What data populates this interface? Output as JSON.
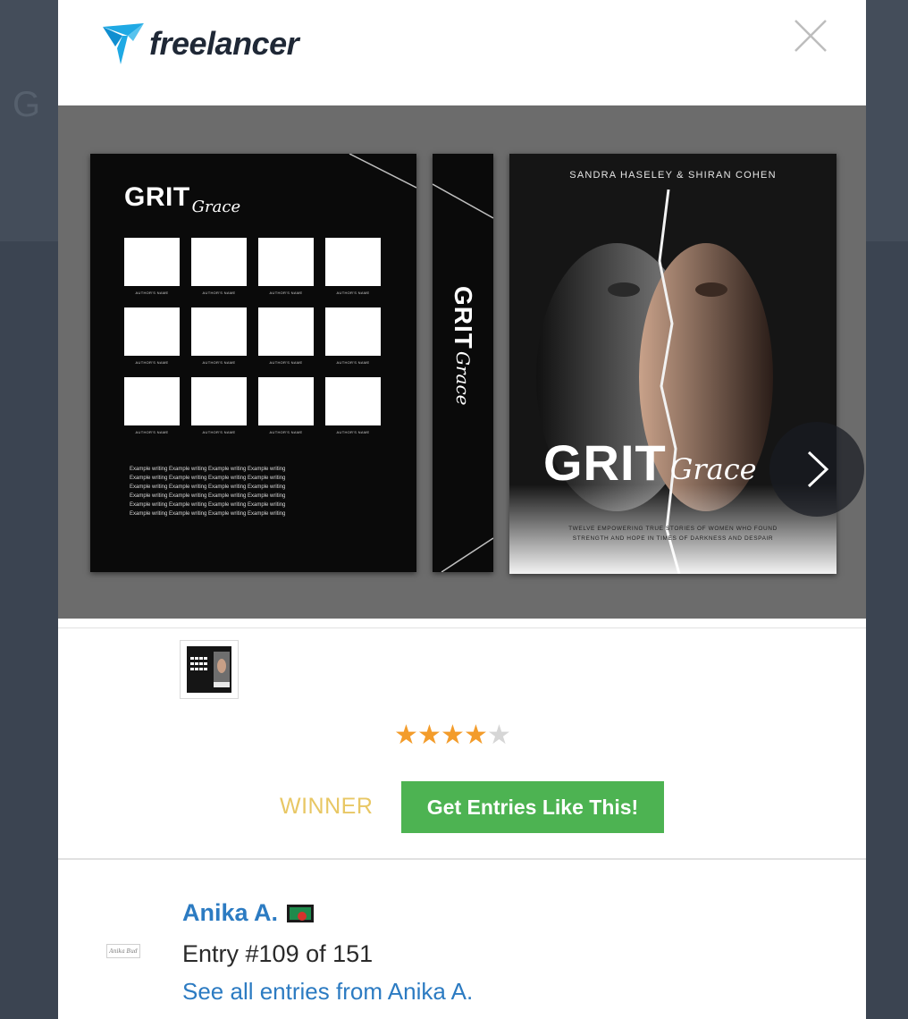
{
  "background": {
    "ghost_text": "G"
  },
  "header": {
    "logo_text": "freelancer",
    "logo_color": "#1fa9e4"
  },
  "design": {
    "back_cover": {
      "title_grit": "GRIT",
      "title_grace": "Grace",
      "photo_label": "AUTHOR'S NAME",
      "blurb_line": "Example writing Example writing Example writing Example writing",
      "blurb_line_count": 6,
      "photo_count": 12
    },
    "spine": {
      "title_grit": "GRIT",
      "title_grace": "Grace"
    },
    "front_cover": {
      "authors": "SANDRA HASELEY & SHIRAN COHEN",
      "title_grit": "GRIT",
      "title_grace": "Grace",
      "subtitle_line1": "TWELVE EMPOWERING TRUE STORIES OF WOMEN WHO FOUND",
      "subtitle_line2": "STRENGTH AND HOPE IN TIMES OF DARKNESS AND DESPAIR"
    }
  },
  "rating": {
    "value": 4,
    "max": 5,
    "filled_color": "#f39c2b",
    "empty_color": "#d6d6d6"
  },
  "actions": {
    "winner_label": "WINNER",
    "cta_label": "Get Entries Like This!",
    "cta_color": "#4db352"
  },
  "entry": {
    "name": "Anika A.",
    "entry_text": "Entry #109 of 151",
    "see_all_label": "See all entries from Anika A.",
    "signature_text": "Anika Bud"
  }
}
